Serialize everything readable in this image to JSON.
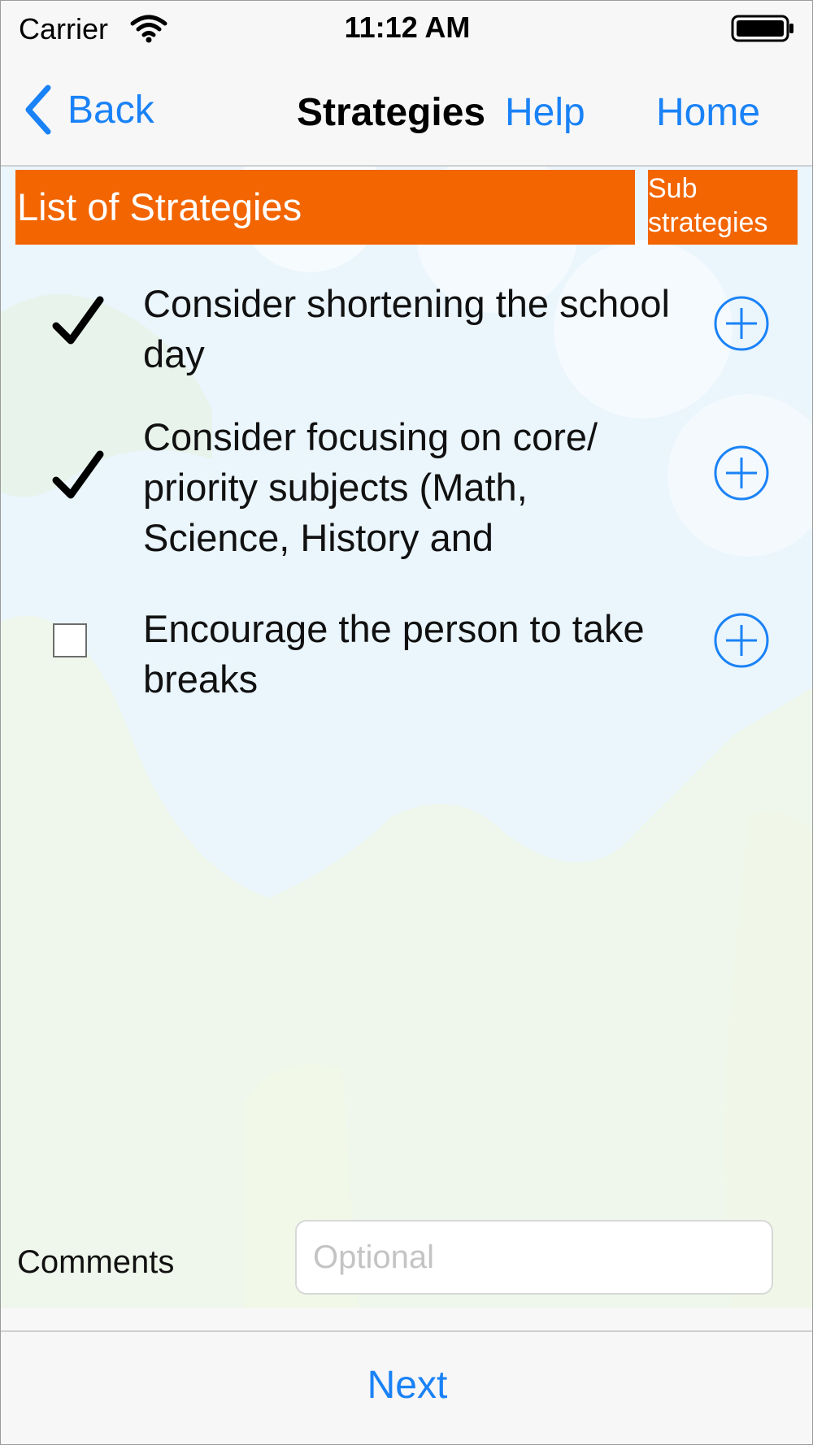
{
  "status_bar": {
    "carrier": "Carrier",
    "time": "11:12 AM"
  },
  "nav": {
    "back_label": "Back",
    "title": "Strategies",
    "help_label": "Help",
    "home_label": "Home"
  },
  "list_header": {
    "title": "List of Strategies",
    "sub_button": "Sub\nstrategies"
  },
  "strategies": [
    {
      "text": "Consider shortening the school day",
      "checked": true
    },
    {
      "text": "Consider focusing on core/ priority subjects (Math, Science, History and",
      "checked": true
    },
    {
      "text": "Encourage the person to take breaks",
      "checked": false
    }
  ],
  "comments": {
    "label": "Comments",
    "placeholder": "Optional",
    "value": ""
  },
  "toolbar": {
    "next_label": "Next"
  },
  "colors": {
    "accent": "#1a82f7",
    "header_orange": "#f26500"
  },
  "icons": {
    "check": "checkmark-icon",
    "add": "plus-circle-icon",
    "back": "chevron-left-icon"
  }
}
